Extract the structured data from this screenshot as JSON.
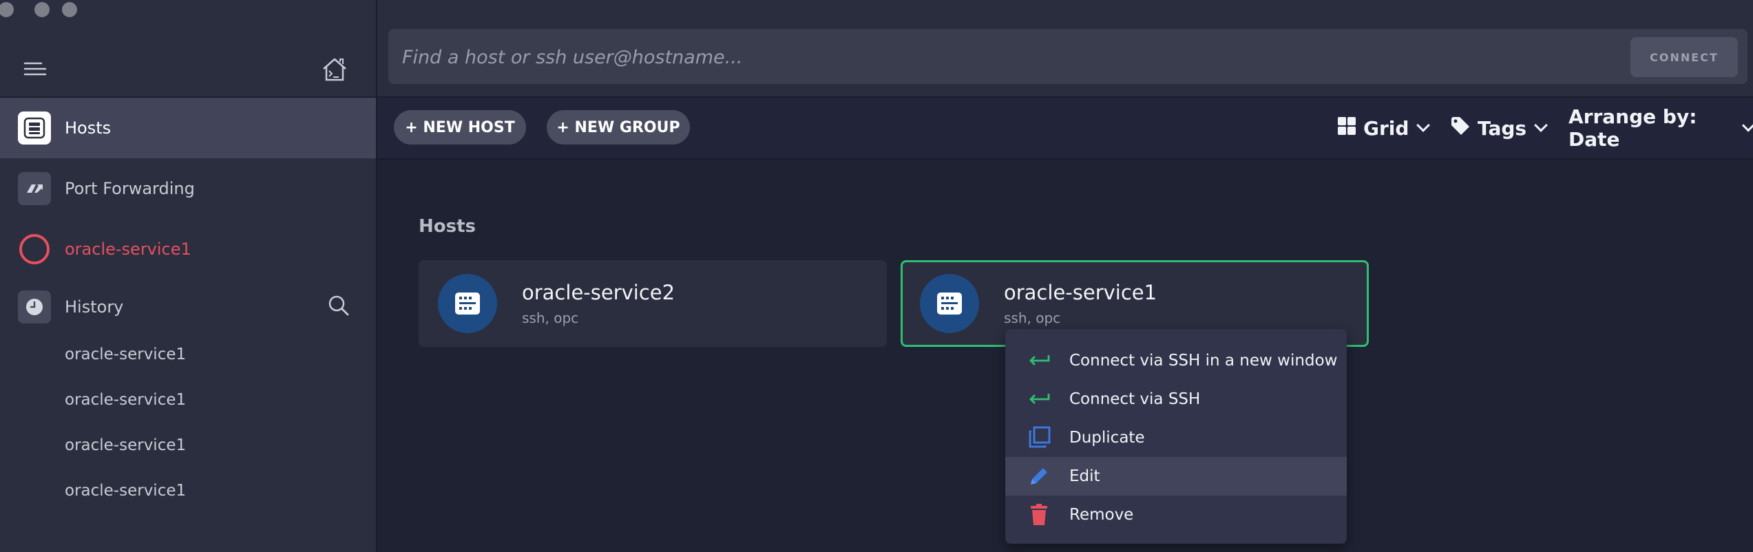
{
  "sidebar": {
    "nav": [
      {
        "label": "Hosts",
        "icon": "server-icon",
        "active": true
      },
      {
        "label": "Port Forwarding",
        "icon": "port-forwarding-icon"
      },
      {
        "label": "oracle-service1",
        "icon": "connecting-ring-icon",
        "color": "#e5505f"
      },
      {
        "label": "History",
        "icon": "clock-icon"
      }
    ],
    "history": [
      "oracle-service1",
      "oracle-service1",
      "oracle-service1",
      "oracle-service1"
    ]
  },
  "search": {
    "placeholder": "Find a host or ssh user@hostname...",
    "value": "",
    "connect_label": "CONNECT"
  },
  "toolbar": {
    "new_host_label": "+ NEW HOST",
    "new_group_label": "+ NEW GROUP",
    "view_label": "Grid",
    "tags_label": "Tags",
    "arrange_label": "Arrange by: Date"
  },
  "main": {
    "section_title": "Hosts",
    "hosts": [
      {
        "name": "oracle-service2",
        "details": "ssh, opc"
      },
      {
        "name": "oracle-service1",
        "details": "ssh, opc",
        "selected": true
      }
    ]
  },
  "context_menu": {
    "items": [
      {
        "label": "Connect via SSH in a new window",
        "icon": "enter-arrow-icon",
        "color": "#2fbf71"
      },
      {
        "label": "Connect via SSH",
        "icon": "enter-arrow-icon",
        "color": "#2fbf71"
      },
      {
        "label": "Duplicate",
        "icon": "duplicate-icon",
        "color": "#3d7be0"
      },
      {
        "label": "Edit",
        "icon": "pencil-icon",
        "color": "#3d7be0",
        "hovered": true
      },
      {
        "label": "Remove",
        "icon": "trash-icon",
        "color": "#e5505f"
      }
    ]
  },
  "colors": {
    "accent_green": "#2fbf71",
    "danger_red": "#e5505f",
    "primary_blue": "#1e4b84"
  }
}
